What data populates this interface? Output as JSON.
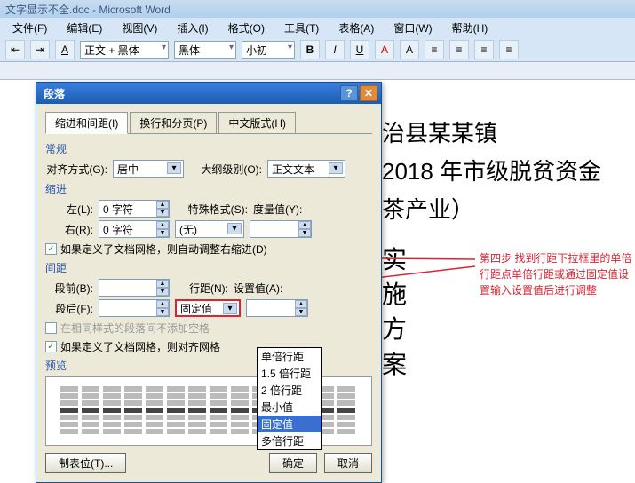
{
  "window": {
    "title": "文字显示不全.doc - Microsoft Word"
  },
  "menu": [
    "文件(F)",
    "编辑(E)",
    "视图(V)",
    "插入(I)",
    "格式(O)",
    "工具(T)",
    "表格(A)",
    "窗口(W)",
    "帮助(H)"
  ],
  "toolbar": {
    "font": "正文 + 黑体",
    "style": "黑体",
    "size": "小初",
    "b": "B",
    "i": "I",
    "u": "U"
  },
  "doc": {
    "l1": "治县某某镇",
    "l2": "2018 年市级脱贫资金",
    "l3": "茶产业）",
    "v1": "实",
    "v2": "施",
    "v3": "方",
    "v4": "案"
  },
  "annotation": "第四步  找到行距下拉框里的单倍行距点单倍行距或通过固定值设置输入设置值后进行调整",
  "dialog": {
    "title": "段落",
    "tabs": [
      "缩进和间距(I)",
      "换行和分页(P)",
      "中文版式(H)"
    ],
    "groups": {
      "general": "常规",
      "indent": "缩进",
      "spacing": "间距",
      "preview": "预览"
    },
    "labels": {
      "align": "对齐方式(G):",
      "outline": "大纲级别(O):",
      "left": "左(L):",
      "right": "右(R):",
      "special": "特殊格式(S):",
      "by": "度量值(Y):",
      "before": "段前(B):",
      "after": "段后(F):",
      "line": "行距(N):",
      "at": "设置值(A):",
      "chk1": "如果定义了文档网格，则自动调整右缩进(D)",
      "chk2": "在相同样式的段落间不添加空格",
      "chk3": "如果定义了文档网格，则对齐网格",
      "tabs_btn": "制表位(T)...",
      "ok": "确定",
      "cancel": "取消"
    },
    "values": {
      "align": "居中",
      "outline": "正文文本",
      "left": "0 字符",
      "right": "0 字符",
      "special": "(无)",
      "by": "",
      "before": "",
      "after": "",
      "line": "固定值",
      "at": ""
    },
    "dropdown_options": [
      "单倍行距",
      "1.5 倍行距",
      "2 倍行距",
      "最小值",
      "固定值",
      "多倍行距"
    ]
  }
}
